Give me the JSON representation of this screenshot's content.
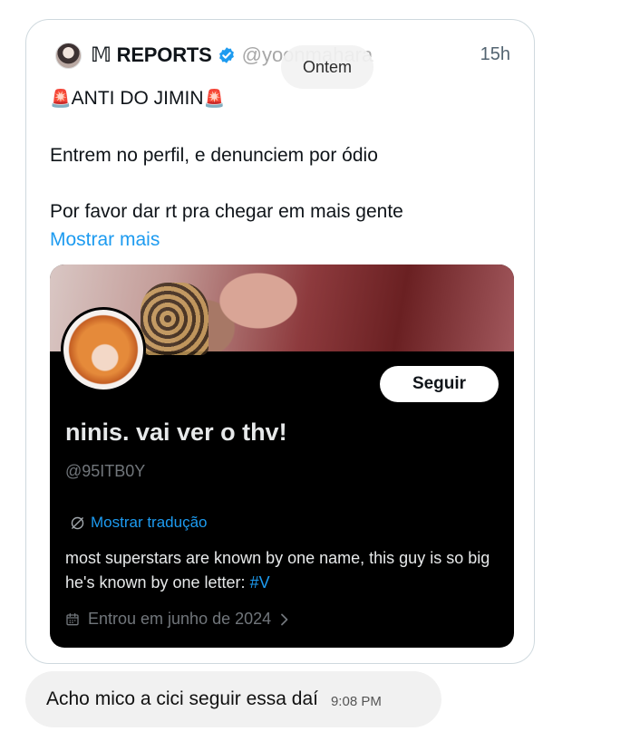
{
  "tweet": {
    "author_name": "𝕄 REPORTS",
    "handle": "@yoonmahara",
    "time": "15h",
    "headline_siren_left": "🚨",
    "headline_text": "ANTI DO JIMIN",
    "headline_siren_right": "🚨",
    "line1": "Entrem no perfil, e denunciem por ódio",
    "line2": "Por favor dar rt pra chegar em mais gente",
    "show_more": "Mostrar mais"
  },
  "profile_card": {
    "follow_label": "Seguir",
    "display_name": "ninis. vai ver o thv!",
    "handle": "@95ITB0Y",
    "translate_label": "Mostrar tradução",
    "bio_text": "most superstars are known by one name, this guy is so big he's known by one letter: ",
    "bio_hashtag": "#V",
    "joined": "Entrou em junho de 2024"
  },
  "date_separator": "Ontem",
  "message": {
    "text": "Acho mico a cici seguir essa daí",
    "time": "9:08 PM"
  },
  "colors": {
    "link": "#1d9bf0",
    "verified": "#1d9bf0",
    "card_bg": "#000000",
    "bubble_bg": "#f1f1f1"
  }
}
